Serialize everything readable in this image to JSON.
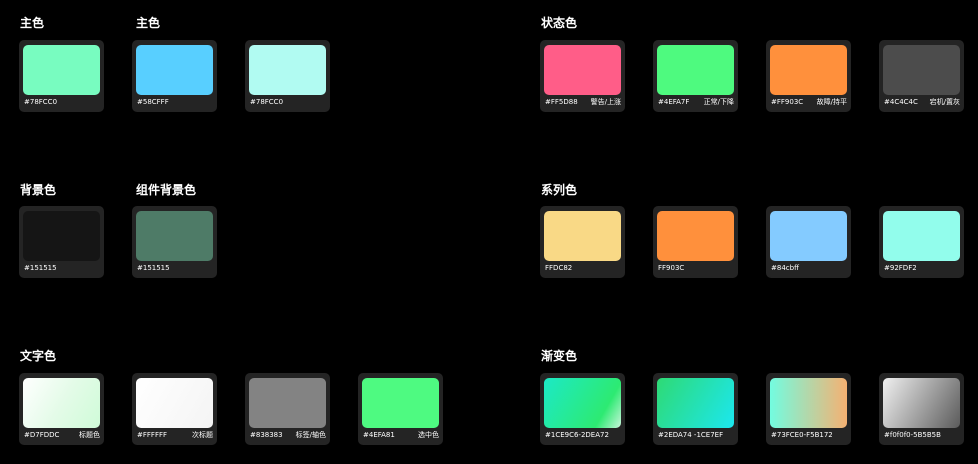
{
  "sections": {
    "primary_a": {
      "title": "主色",
      "swatches": [
        {
          "code": "#78FCC0",
          "name": "",
          "color": "#78FCC0"
        }
      ]
    },
    "primary_b": {
      "title": "主色",
      "swatches": [
        {
          "code": "#58CFFF",
          "name": "",
          "color": "#58CFFF"
        },
        {
          "code": "#78FCC0",
          "name": "",
          "color": "#B1FBF2"
        }
      ]
    },
    "status": {
      "title": "状态色",
      "swatches": [
        {
          "code": "#FF5D88",
          "name": "警告/上涨",
          "color": "#FF5D88"
        },
        {
          "code": "#4EFA7F",
          "name": "正常/下降",
          "color": "#4EFA7F"
        },
        {
          "code": "#FF903C",
          "name": "故障/持平",
          "color": "#FF903C"
        },
        {
          "code": "#4C4C4C",
          "name": "宕机/置灰",
          "color": "#4C4C4C"
        }
      ]
    },
    "background": {
      "title": "背景色",
      "swatches": [
        {
          "code": "#151515",
          "name": "",
          "color": "#151515"
        }
      ]
    },
    "component_background": {
      "title": "组件背景色",
      "swatches": [
        {
          "code": "#151515",
          "name": "",
          "color": "#4E7B67"
        }
      ]
    },
    "series": {
      "title": "系列色",
      "swatches": [
        {
          "code": "FFDC82",
          "name": "",
          "color": "#F9D986"
        },
        {
          "code": "FF903C",
          "name": "",
          "color": "#FF903C"
        },
        {
          "code": "#84cbff",
          "name": "",
          "color": "#84CBFF"
        },
        {
          "code": "#92FDF2",
          "name": "",
          "color": "#92FDEC"
        }
      ]
    },
    "text": {
      "title": "文字色",
      "swatches": [
        {
          "code": "#D7FDDC",
          "name": "标题色",
          "color": "#D7FDDC"
        },
        {
          "code": "#FFFFFF",
          "name": "次标题",
          "color": "#FFFFFF"
        },
        {
          "code": "#838383",
          "name": "标签/轴色",
          "color": "#838383"
        },
        {
          "code": "#4EFA81",
          "name": "选中色",
          "color": "#4EFA81"
        }
      ]
    },
    "gradient": {
      "title": "渐变色",
      "swatches": [
        {
          "code": "#1CE9C6-2DEA72",
          "name": "",
          "color": "#1CE9C6"
        },
        {
          "code": "#2EDA74 -1CE7EF",
          "name": "",
          "color": "#2EDA74"
        },
        {
          "code": "#73FCE0-F5B172",
          "name": "",
          "color": "#73FCE0"
        },
        {
          "code": "#f0f0f0-5B5B5B",
          "name": "",
          "color": "#f0f0f0"
        }
      ]
    }
  }
}
